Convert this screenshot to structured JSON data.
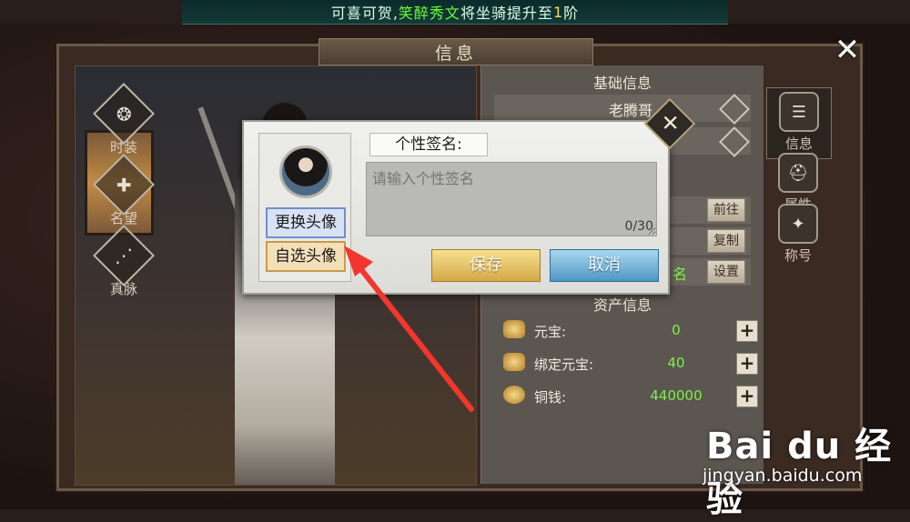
{
  "announcement": {
    "prefix": "可喜可贺,",
    "player": "笑醉秀文",
    "middle": "将坐骑提升至",
    "level": "1",
    "suffix": "阶"
  },
  "window": {
    "title": "信息"
  },
  "left_menu": [
    {
      "label": "时装",
      "icon": "fashion-icon"
    },
    {
      "label": "名望",
      "icon": "fame-icon"
    },
    {
      "label": "真脉",
      "icon": "meridian-icon"
    }
  ],
  "right_tabs": [
    {
      "label": "信息",
      "icon": "scroll-icon"
    },
    {
      "label": "属性",
      "icon": "helmet-icon"
    },
    {
      "label": "称号",
      "icon": "title-badge-icon"
    }
  ],
  "basic_info": {
    "heading": "基础信息",
    "player_name": "老腾哥",
    "buttons": [
      "前往",
      "复制",
      "设置"
    ],
    "partial_label": "名"
  },
  "assets": {
    "heading": "资产信息",
    "items": [
      {
        "label": "元宝:",
        "value": "0",
        "icon": "gold-ingot-icon"
      },
      {
        "label": "绑定元宝:",
        "value": "40",
        "icon": "bound-ingot-icon"
      },
      {
        "label": "铜钱:",
        "value": "440000",
        "icon": "copper-coin-icon"
      }
    ]
  },
  "dialog": {
    "change_avatar": "更换头像",
    "choose_avatar": "自选头像",
    "signature_label": "个性签名:",
    "signature_placeholder": "请输入个性签名",
    "signature_count": "0/30",
    "save": "保存",
    "cancel": "取消"
  },
  "watermark": {
    "logo": "Bai du 经验",
    "url": "jingyan.baidu.com"
  },
  "colors": {
    "highlight_name": "#6cff3b",
    "highlight_level": "#ffd84a",
    "asset_value": "#7cf04a"
  }
}
